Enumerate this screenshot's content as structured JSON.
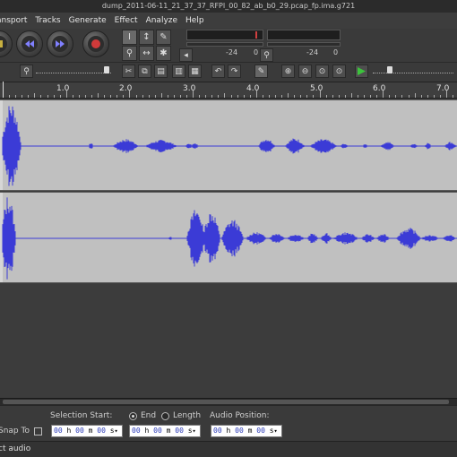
{
  "window": {
    "title": "dump_2011-06-11_21_37_37_RFPI_00_82_ab_b0_29.pcap_fp.ima.g721"
  },
  "menu": [
    {
      "label": "ansport"
    },
    {
      "label": "Tracks"
    },
    {
      "label": "Generate"
    },
    {
      "label": "Effect"
    },
    {
      "label": "Analyze"
    },
    {
      "label": "Help"
    }
  ],
  "meter": {
    "left_db": "-24",
    "right_db": "-24",
    "zero": "0"
  },
  "ruler": {
    "ticks": [
      "1.0",
      "2.0",
      "3.0",
      "4.0",
      "5.0",
      "6.0",
      "7.0"
    ]
  },
  "selection": {
    "snap_to_label": "Snap To",
    "selection_start_label": "Selection Start:",
    "end_label": "End",
    "length_label": "Length",
    "audio_position_label": "Audio Position:",
    "selection_start_value": {
      "h": "00",
      "m": "00",
      "s": "00"
    },
    "end_value": {
      "h": "00",
      "m": "00",
      "s": "00"
    },
    "audio_position_value": {
      "h": "00",
      "m": "00",
      "s": "00"
    },
    "unit_h": "h",
    "unit_m": "m",
    "unit_s": "s"
  },
  "status": {
    "text": "ct audio"
  },
  "colors": {
    "waveform": "#3b3bd6",
    "track_bg": "#c0c0c0",
    "background": "#3c3c3c"
  },
  "icons": {
    "play": "play-icon",
    "pause": "pause-icon",
    "stop": "stop-icon",
    "skip_start": "skip-start-icon",
    "skip_end": "skip-end-icon",
    "record": "record-icon"
  }
}
